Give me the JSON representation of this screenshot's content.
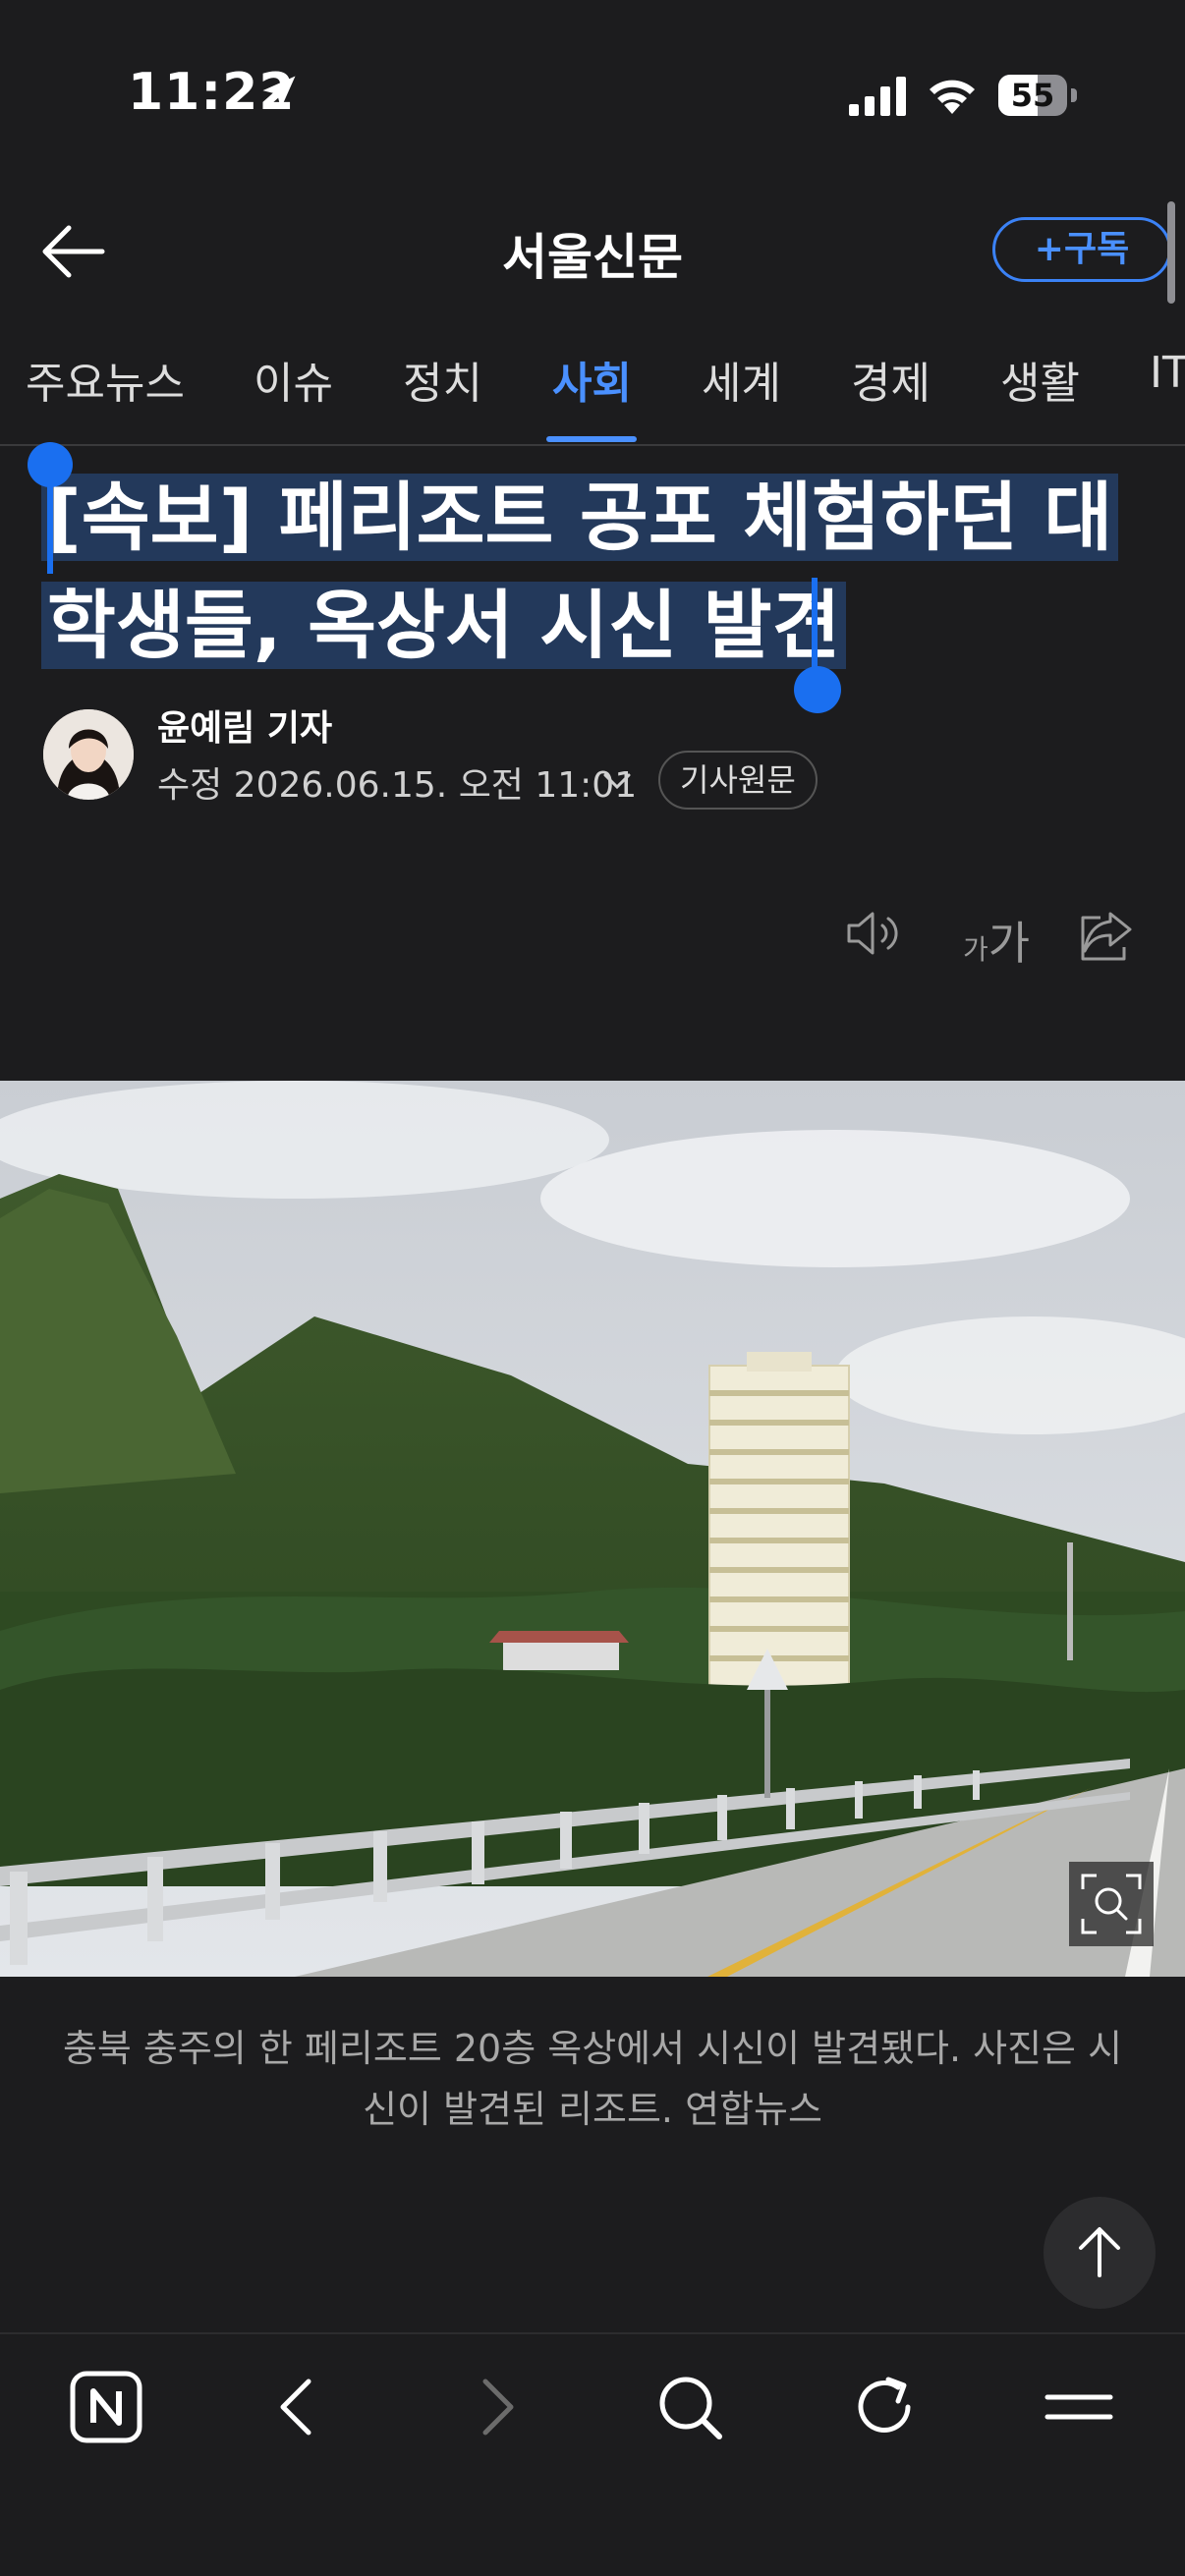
{
  "status_bar": {
    "time": "11:22",
    "battery": "55"
  },
  "header": {
    "title": "서울신문",
    "subscribe_label": "+구독"
  },
  "tabs": [
    {
      "label": "주요뉴스",
      "active": false
    },
    {
      "label": "이슈",
      "active": false
    },
    {
      "label": "정치",
      "active": false
    },
    {
      "label": "사회",
      "active": true
    },
    {
      "label": "세계",
      "active": false
    },
    {
      "label": "경제",
      "active": false
    },
    {
      "label": "생활",
      "active": false
    },
    {
      "label": "IT",
      "active": false
    }
  ],
  "article": {
    "headline_line1": "[속보] 페리조트 공포 체험하던 대",
    "headline_line2": "학생들, 옥상서 시신 발견",
    "reporter": "윤예림 기자",
    "modified": "수정 2026.06.15. 오전 11:01",
    "original_link": "기사원문",
    "font_size_small": "가",
    "font_size_large": "가",
    "caption": "충북 충주의 한 페리조트 20층 옥상에서 시신이 발견됐다. 사진은 시신이 발견된 리조트. 연합뉴스"
  },
  "colors": {
    "background": "#1c1c1e",
    "accent": "#4a90ff",
    "selection": "#23395b",
    "selection_handle": "#1a6ff0"
  },
  "toolbar": {
    "icons": [
      "naver-n-icon",
      "back-chevron-icon",
      "forward-chevron-icon",
      "search-icon",
      "reload-icon",
      "menu-icon"
    ]
  }
}
